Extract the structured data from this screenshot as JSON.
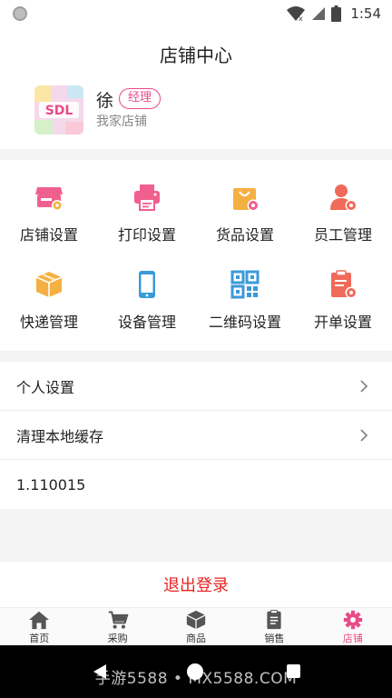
{
  "status_bar": {
    "time": "1:54",
    "icons": [
      "circle-notification-icon",
      "wifi-icon",
      "signal-icon",
      "battery-icon"
    ]
  },
  "header": {
    "title": "店铺中心"
  },
  "profile": {
    "avatar_text": "SDL",
    "name": "徐",
    "role_badge": "经理",
    "shop_name": "我家店铺"
  },
  "grid": {
    "items": [
      {
        "label": "店铺设置",
        "icon": "store-settings-icon"
      },
      {
        "label": "打印设置",
        "icon": "printer-icon"
      },
      {
        "label": "货品设置",
        "icon": "goods-bag-icon"
      },
      {
        "label": "员工管理",
        "icon": "staff-icon"
      },
      {
        "label": "快递管理",
        "icon": "express-box-icon"
      },
      {
        "label": "设备管理",
        "icon": "phone-device-icon"
      },
      {
        "label": "二维码设置",
        "icon": "qr-code-icon"
      },
      {
        "label": "开单设置",
        "icon": "order-clipboard-icon"
      }
    ]
  },
  "menu": {
    "personal_settings": "个人设置",
    "clear_cache": "清理本地缓存",
    "version": "1.110015"
  },
  "logout_label": "退出登录",
  "tabbar": {
    "items": [
      {
        "label": "首页",
        "icon": "home-icon",
        "active": false
      },
      {
        "label": "采购",
        "icon": "cart-icon",
        "active": false
      },
      {
        "label": "商品",
        "icon": "cube-icon",
        "active": false
      },
      {
        "label": "销售",
        "icon": "clipboard-icon",
        "active": false
      },
      {
        "label": "店铺",
        "icon": "gear-icon",
        "active": true
      }
    ]
  },
  "watermark": "手游5588 • MX5588.COM",
  "colors": {
    "accent": "#e94b88",
    "logout": "#e8221f",
    "icon_pink": "#f0608e",
    "icon_orange": "#f5b043",
    "icon_blue": "#3a9ad9",
    "icon_red": "#f06a5a"
  }
}
